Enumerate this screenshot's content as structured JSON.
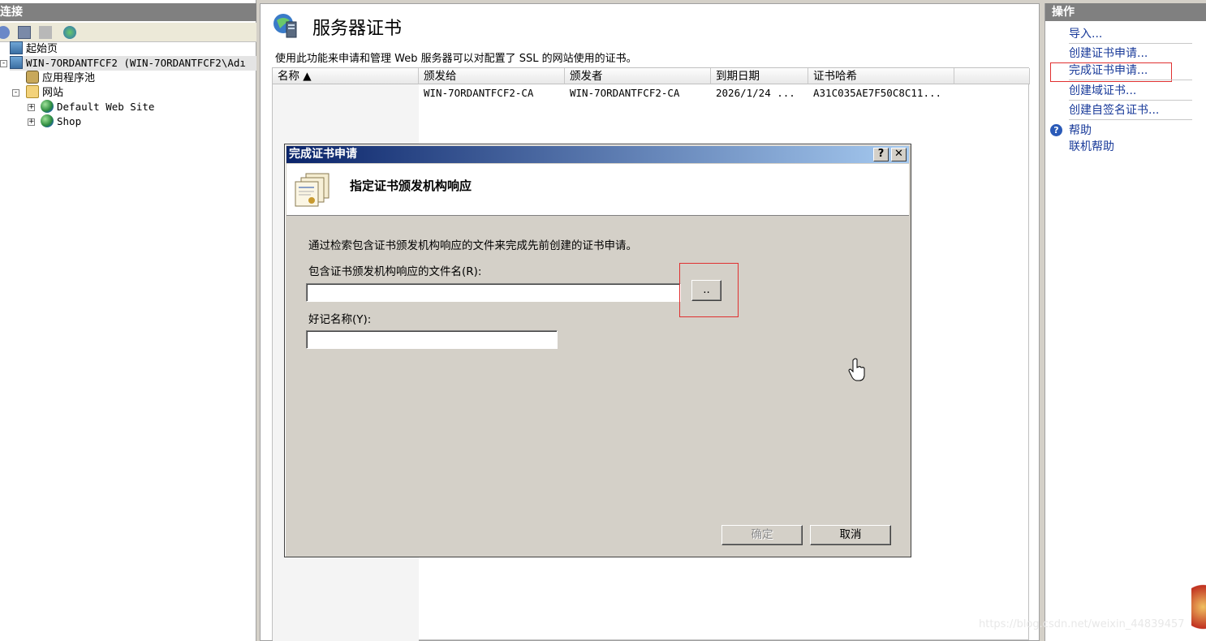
{
  "connections": {
    "header": "连接",
    "tree": {
      "start_page": "起始页",
      "server": "WIN-7ORDANTFCF2 (WIN-7ORDANTFCF2\\Adı",
      "app_pools": "应用程序池",
      "sites": "网站",
      "site_default": "Default Web Site",
      "site_shop": "Shop"
    },
    "expander_symbol_minus": "-",
    "expander_symbol_plus": "+"
  },
  "main": {
    "title": "服务器证书",
    "description": "使用此功能来申请和管理 Web 服务器可以对配置了 SSL 的网站使用的证书。",
    "columns": [
      "名称 ▲",
      "颁发给",
      "颁发者",
      "到期日期",
      "证书哈希"
    ],
    "rows": [
      {
        "name": "",
        "issued_to": "WIN-7ORDANTFCF2-CA",
        "issued_by": "WIN-7ORDANTFCF2-CA",
        "expiry": "2026/1/24 ...",
        "hash": "A31C035AE7F50C8C11..."
      }
    ]
  },
  "actions": {
    "header": "操作",
    "items": {
      "import": "导入...",
      "create_request": "创建证书申请...",
      "complete_request": "完成证书申请...",
      "create_domain": "创建域证书...",
      "create_self_signed": "创建自签名证书...",
      "help": "帮助",
      "online_help": "联机帮助"
    }
  },
  "dialog": {
    "title": "完成证书申请",
    "help_glyph": "?",
    "close_glyph": "✕",
    "banner": "指定证书颁发机构响应",
    "intro": "通过检索包含证书颁发机构响应的文件来完成先前创建的证书申请。",
    "file_label": "包含证书颁发机构响应的文件名(R):",
    "file_value": "",
    "browse_label": "..",
    "friendly_label": "好记名称(Y):",
    "friendly_value": "",
    "ok_label": "确定",
    "cancel_label": "取消"
  },
  "watermark": "https://blog.csdn.net/weixin_44839457",
  "colors": {
    "link": "#1a3b9a",
    "highlight": "#e03030",
    "titlebar_start": "#0a246a",
    "titlebar_end": "#a6caf0"
  }
}
